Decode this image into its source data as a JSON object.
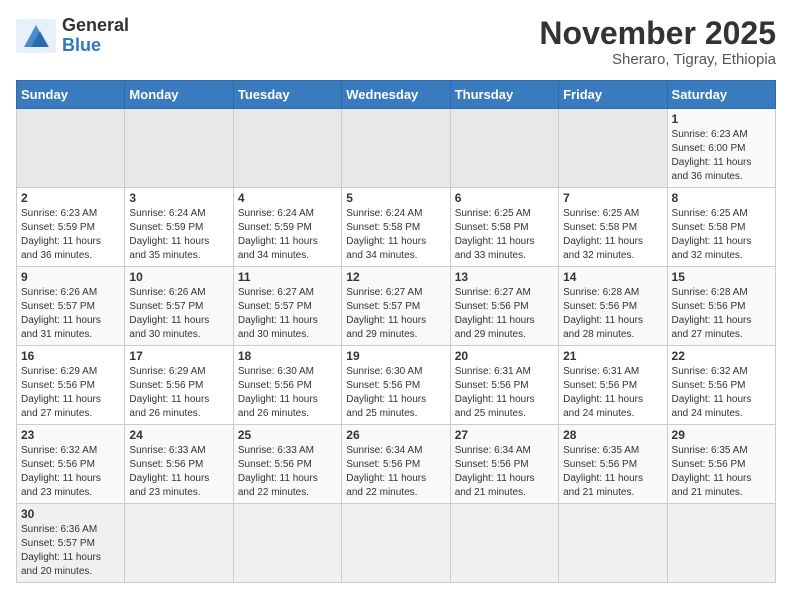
{
  "header": {
    "logo_general": "General",
    "logo_blue": "Blue",
    "month_title": "November 2025",
    "location": "Sheraro, Tigray, Ethiopia"
  },
  "weekdays": [
    "Sunday",
    "Monday",
    "Tuesday",
    "Wednesday",
    "Thursday",
    "Friday",
    "Saturday"
  ],
  "weeks": [
    [
      {
        "day": "",
        "info": ""
      },
      {
        "day": "",
        "info": ""
      },
      {
        "day": "",
        "info": ""
      },
      {
        "day": "",
        "info": ""
      },
      {
        "day": "",
        "info": ""
      },
      {
        "day": "",
        "info": ""
      },
      {
        "day": "1",
        "info": "Sunrise: 6:23 AM\nSunset: 6:00 PM\nDaylight: 11 hours\nand 36 minutes."
      }
    ],
    [
      {
        "day": "2",
        "info": "Sunrise: 6:23 AM\nSunset: 5:59 PM\nDaylight: 11 hours\nand 36 minutes."
      },
      {
        "day": "3",
        "info": "Sunrise: 6:24 AM\nSunset: 5:59 PM\nDaylight: 11 hours\nand 35 minutes."
      },
      {
        "day": "4",
        "info": "Sunrise: 6:24 AM\nSunset: 5:59 PM\nDaylight: 11 hours\nand 34 minutes."
      },
      {
        "day": "5",
        "info": "Sunrise: 6:24 AM\nSunset: 5:58 PM\nDaylight: 11 hours\nand 34 minutes."
      },
      {
        "day": "6",
        "info": "Sunrise: 6:25 AM\nSunset: 5:58 PM\nDaylight: 11 hours\nand 33 minutes."
      },
      {
        "day": "7",
        "info": "Sunrise: 6:25 AM\nSunset: 5:58 PM\nDaylight: 11 hours\nand 32 minutes."
      },
      {
        "day": "8",
        "info": "Sunrise: 6:25 AM\nSunset: 5:58 PM\nDaylight: 11 hours\nand 32 minutes."
      }
    ],
    [
      {
        "day": "9",
        "info": "Sunrise: 6:26 AM\nSunset: 5:57 PM\nDaylight: 11 hours\nand 31 minutes."
      },
      {
        "day": "10",
        "info": "Sunrise: 6:26 AM\nSunset: 5:57 PM\nDaylight: 11 hours\nand 30 minutes."
      },
      {
        "day": "11",
        "info": "Sunrise: 6:27 AM\nSunset: 5:57 PM\nDaylight: 11 hours\nand 30 minutes."
      },
      {
        "day": "12",
        "info": "Sunrise: 6:27 AM\nSunset: 5:57 PM\nDaylight: 11 hours\nand 29 minutes."
      },
      {
        "day": "13",
        "info": "Sunrise: 6:27 AM\nSunset: 5:56 PM\nDaylight: 11 hours\nand 29 minutes."
      },
      {
        "day": "14",
        "info": "Sunrise: 6:28 AM\nSunset: 5:56 PM\nDaylight: 11 hours\nand 28 minutes."
      },
      {
        "day": "15",
        "info": "Sunrise: 6:28 AM\nSunset: 5:56 PM\nDaylight: 11 hours\nand 27 minutes."
      }
    ],
    [
      {
        "day": "16",
        "info": "Sunrise: 6:29 AM\nSunset: 5:56 PM\nDaylight: 11 hours\nand 27 minutes."
      },
      {
        "day": "17",
        "info": "Sunrise: 6:29 AM\nSunset: 5:56 PM\nDaylight: 11 hours\nand 26 minutes."
      },
      {
        "day": "18",
        "info": "Sunrise: 6:30 AM\nSunset: 5:56 PM\nDaylight: 11 hours\nand 26 minutes."
      },
      {
        "day": "19",
        "info": "Sunrise: 6:30 AM\nSunset: 5:56 PM\nDaylight: 11 hours\nand 25 minutes."
      },
      {
        "day": "20",
        "info": "Sunrise: 6:31 AM\nSunset: 5:56 PM\nDaylight: 11 hours\nand 25 minutes."
      },
      {
        "day": "21",
        "info": "Sunrise: 6:31 AM\nSunset: 5:56 PM\nDaylight: 11 hours\nand 24 minutes."
      },
      {
        "day": "22",
        "info": "Sunrise: 6:32 AM\nSunset: 5:56 PM\nDaylight: 11 hours\nand 24 minutes."
      }
    ],
    [
      {
        "day": "23",
        "info": "Sunrise: 6:32 AM\nSunset: 5:56 PM\nDaylight: 11 hours\nand 23 minutes."
      },
      {
        "day": "24",
        "info": "Sunrise: 6:33 AM\nSunset: 5:56 PM\nDaylight: 11 hours\nand 23 minutes."
      },
      {
        "day": "25",
        "info": "Sunrise: 6:33 AM\nSunset: 5:56 PM\nDaylight: 11 hours\nand 22 minutes."
      },
      {
        "day": "26",
        "info": "Sunrise: 6:34 AM\nSunset: 5:56 PM\nDaylight: 11 hours\nand 22 minutes."
      },
      {
        "day": "27",
        "info": "Sunrise: 6:34 AM\nSunset: 5:56 PM\nDaylight: 11 hours\nand 21 minutes."
      },
      {
        "day": "28",
        "info": "Sunrise: 6:35 AM\nSunset: 5:56 PM\nDaylight: 11 hours\nand 21 minutes."
      },
      {
        "day": "29",
        "info": "Sunrise: 6:35 AM\nSunset: 5:56 PM\nDaylight: 11 hours\nand 21 minutes."
      }
    ],
    [
      {
        "day": "30",
        "info": "Sunrise: 6:36 AM\nSunset: 5:57 PM\nDaylight: 11 hours\nand 20 minutes."
      },
      {
        "day": "",
        "info": ""
      },
      {
        "day": "",
        "info": ""
      },
      {
        "day": "",
        "info": ""
      },
      {
        "day": "",
        "info": ""
      },
      {
        "day": "",
        "info": ""
      },
      {
        "day": "",
        "info": ""
      }
    ]
  ]
}
